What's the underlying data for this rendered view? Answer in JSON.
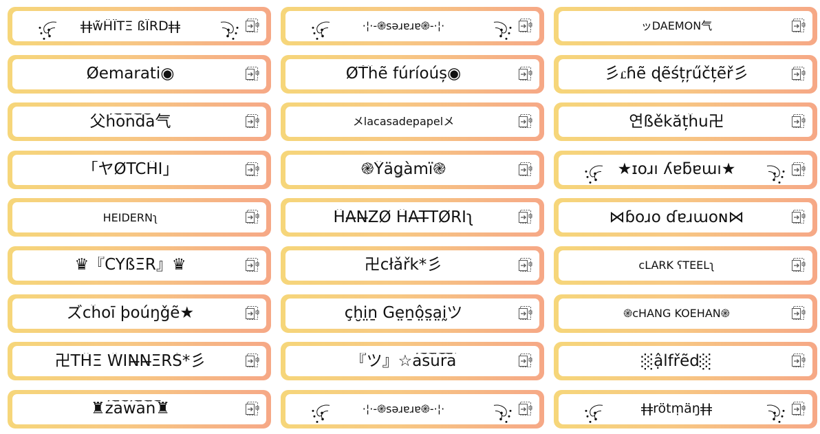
{
  "cards": [
    {
      "text": "ǂǂw̃ĤÏTΞ ßÏRDǂǂ",
      "icon": "copy-icon",
      "swirls": true,
      "size": "medium"
    },
    {
      "text": "·¦·-֎ꜱǝɹɐɹɐ֎-·¦·",
      "icon": "copy-icon",
      "swirls": true,
      "size": "small"
    },
    {
      "text": "ッDAEMON气",
      "icon": "copy-icon",
      "swirls": false,
      "size": "small"
    },
    {
      "text": "Øemarati◉",
      "icon": "copy-icon",
      "swirls": false,
      "size": "normal"
    },
    {
      "text": "ØŤĥẽ fúríoúș◉",
      "icon": "copy-icon",
      "swirls": false,
      "size": "normal"
    },
    {
      "text": "彡ꮭɦẽ ɖẽśțŗűčțẽř彡",
      "icon": "copy-icon",
      "swirls": false,
      "size": "normal"
    },
    {
      "text": "父h͠o͠n͠d͠a气",
      "icon": "copy-icon",
      "swirls": false,
      "size": "normal"
    },
    {
      "text": "メlacasadepapelメ",
      "icon": "copy-icon",
      "swirls": false,
      "size": "small"
    },
    {
      "text": "연ßěkățĥu卍",
      "icon": "copy-icon",
      "swirls": false,
      "size": "normal"
    },
    {
      "text": "「ヤØTCĤÏ」",
      "icon": "copy-icon",
      "swirls": false,
      "size": "normal"
    },
    {
      "text": "֎Ŷäǥàmï֎",
      "icon": "copy-icon",
      "swirls": false,
      "size": "normal"
    },
    {
      "text": "★ɪoɹı ʎɐƃɐɯı★",
      "icon": "copy-icon",
      "swirls": true,
      "size": "normal"
    },
    {
      "text": "HEIDERNʅ",
      "icon": "copy-icon",
      "swirls": false,
      "size": "small"
    },
    {
      "text": "ĤA̶N̶ZØ ĤA̶T̶TØRÏʅ",
      "icon": "copy-icon",
      "swirls": false,
      "size": "normal"
    },
    {
      "text": "⋈ɓoɹo ɗɐɹɯoɴ⋈",
      "icon": "copy-icon",
      "swirls": false,
      "size": "normal"
    },
    {
      "text": "♛『CŸßΞR』♛",
      "icon": "copy-icon",
      "swirls": false,
      "size": "normal"
    },
    {
      "text": "卍cłǎřk*彡",
      "icon": "copy-icon",
      "swirls": false,
      "size": "normal"
    },
    {
      "text": "cLARK ʕTEELʅ",
      "icon": "copy-icon",
      "swirls": false,
      "size": "small"
    },
    {
      "text": "ズcĥoī þoúŋǧẽ★",
      "icon": "copy-icon",
      "swirls": false,
      "size": "normal"
    },
    {
      "text": "çḫi̤ṉ Ğe̤ṉô̤s̤a̤ḭツ",
      "icon": "copy-icon",
      "swirls": false,
      "size": "normal"
    },
    {
      "text": "֎cHANG KOEHAN֎",
      "icon": "copy-icon",
      "swirls": false,
      "size": "small"
    },
    {
      "text": "卍TĤΞ W̃ÏN̶N̶ΞRŠ*彡",
      "icon": "copy-icon",
      "swirls": false,
      "size": "normal"
    },
    {
      "text": "『ツ』☆a͠s͠u͠r͠a͠",
      "icon": "copy-icon",
      "swirls": false,
      "size": "normal"
    },
    {
      "text": "░ậlfřẽd░",
      "icon": "copy-icon",
      "swirls": false,
      "size": "normal"
    },
    {
      "text": "♜z͠a͠w͠a͠n͠♜",
      "icon": "copy-icon",
      "swirls": false,
      "size": "normal"
    },
    {
      "text": "·¦·-֎ꜱǝɹɐɹɐ֎-·¦·",
      "icon": "copy-icon",
      "swirls": true,
      "size": "small"
    },
    {
      "text": "ǂǂrötṃäŋǂǂ",
      "icon": "copy-icon",
      "swirls": true,
      "size": "medium"
    }
  ],
  "colors": {
    "border_start": "#f6d67a",
    "border_end": "#f6a886",
    "text": "#111111",
    "icon": "#555555"
  }
}
